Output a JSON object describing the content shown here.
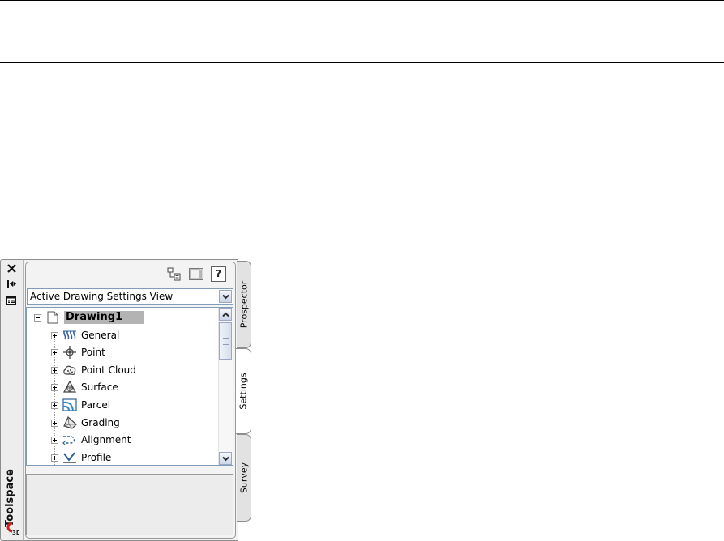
{
  "toolspace": {
    "title": "Toolspace",
    "dropdown": {
      "selected": "Active Drawing Settings View"
    },
    "tree": {
      "root": "Drawing1",
      "items": [
        {
          "label": "General",
          "icon": "general-settings-icon"
        },
        {
          "label": "Point",
          "icon": "point-icon"
        },
        {
          "label": "Point Cloud",
          "icon": "point-cloud-icon"
        },
        {
          "label": "Surface",
          "icon": "surface-icon"
        },
        {
          "label": "Parcel",
          "icon": "parcel-icon"
        },
        {
          "label": "Grading",
          "icon": "grading-icon"
        },
        {
          "label": "Alignment",
          "icon": "alignment-icon"
        },
        {
          "label": "Profile",
          "icon": "profile-icon"
        }
      ]
    },
    "help_label": "?",
    "tabs": [
      {
        "label": "Prospector",
        "active": false
      },
      {
        "label": "Settings",
        "active": true
      },
      {
        "label": "Survey",
        "active": false
      }
    ]
  },
  "colors": {
    "selection": "#b3b3b3",
    "panel_bg": "#f2f2f2",
    "field_border": "#7f9db9"
  }
}
